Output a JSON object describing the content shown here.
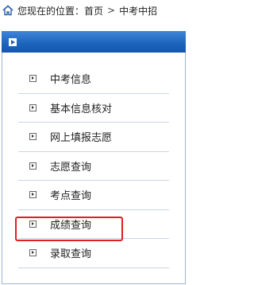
{
  "breadcrumb": {
    "label": "您现在的位置：",
    "home": "首页",
    "separator": ">",
    "current": "中考中招"
  },
  "menu": {
    "items": [
      {
        "label": "中考信息"
      },
      {
        "label": "基本信息核对"
      },
      {
        "label": "网上填报志愿"
      },
      {
        "label": "志愿查询"
      },
      {
        "label": "考点查询"
      },
      {
        "label": "成绩查询"
      },
      {
        "label": "录取查询"
      }
    ],
    "highlighted_item": "成绩查询"
  },
  "colors": {
    "header_blue": "#1c63bd",
    "highlight_red": "#e31e1e",
    "divider": "#c9d6e6"
  }
}
